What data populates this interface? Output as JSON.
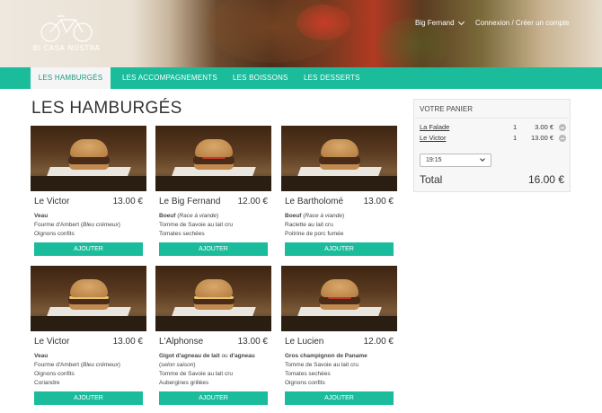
{
  "header": {
    "logo_text": "BI CASA NOSTRA",
    "user_name": "Big Fernand",
    "login_link": "Connexion / Créer un compte"
  },
  "nav": {
    "tabs": [
      {
        "label": "LES HAMBURGÉS",
        "active": true
      },
      {
        "label": "LES ACCOMPAGNEMENTS",
        "active": false
      },
      {
        "label": "LES BOISSONS",
        "active": false
      },
      {
        "label": "LES DESSERTS",
        "active": false
      }
    ]
  },
  "page": {
    "title": "LES HAMBURGÉS"
  },
  "products": [
    {
      "name": "Le Victor",
      "price": "13.00 €",
      "desc": [
        "<b>Veau</b>",
        "Fourme d'Ambert (<i>Bleu crémeux</i>)",
        "Oignons confits"
      ],
      "button": "AJOUTER",
      "topping": "none"
    },
    {
      "name": "Le Big Fernand",
      "price": "12.00 €",
      "desc": [
        "<b>Boeuf</b> (<i>Race à viande</i>)",
        "Tomme de Savoie au lait cru",
        "Tomates sechées"
      ],
      "button": "AJOUTER",
      "topping": "tomato"
    },
    {
      "name": "Le Bartholomé",
      "price": "13.00 €",
      "desc": [
        "<b>Boeuf</b> (<i>Race à viande</i>)",
        "Raclette au lait cru",
        "Poitrine de porc fumée"
      ],
      "button": "AJOUTER",
      "topping": "none"
    },
    {
      "name": "Le Victor",
      "price": "13.00 €",
      "desc": [
        "<b>Veau</b>",
        "Fourme d'Ambert (<i>Bleu crémeux</i>)",
        "Oignons confits",
        "Coriandre"
      ],
      "button": "AJOUTER",
      "topping": "cheese"
    },
    {
      "name": "L'Alphonse",
      "price": "13.00 €",
      "desc": [
        "<b>Gigot d'agneau de lait</b> ou <b>d'agneau</b>",
        "(<i>selon saison</i>)",
        "Tomme de Savoie au lait cru",
        "Aubergines grillées"
      ],
      "button": "AJOUTER",
      "topping": "cheese"
    },
    {
      "name": "Le Lucien",
      "price": "12.00 €",
      "desc": [
        "<b>Gros champignon de Paname</b>",
        "Tomme de Savoie au lait cru",
        "Tomates sechées",
        "Oignons confits"
      ],
      "button": "AJOUTER",
      "topping": "tomato"
    }
  ],
  "cart": {
    "title": "VOTRE PANIER",
    "items": [
      {
        "name": "La Falade",
        "qty": "1",
        "price": "3.00 €"
      },
      {
        "name": "Le Victor",
        "qty": "1",
        "price": "13.00 €"
      }
    ],
    "time": "19:15",
    "total_label": "Total",
    "total_value": "16.00 €"
  },
  "colors": {
    "accent": "#1abc9c"
  }
}
